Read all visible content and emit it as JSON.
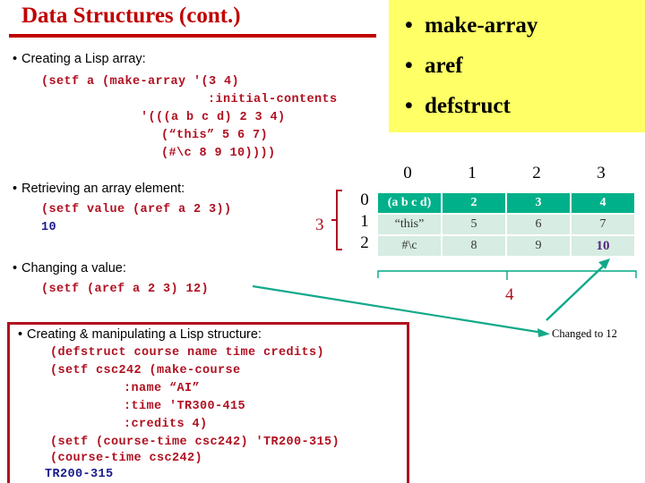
{
  "slide": {
    "title": "Data Structures (cont.)",
    "accent_red": "#c00000",
    "code_red": "#b01020",
    "output_blue": "#1a1a8c",
    "teal": "#00b08a",
    "teal_light": "#d7ece2",
    "yellow": "#ffff66",
    "highlight_purple": "#55257d"
  },
  "bullets": {
    "creating_array": "Creating a Lisp array:",
    "retrieving": "Retrieving an array element:",
    "changing": "Changing a value:",
    "structure": "Creating & manipulating a Lisp structure:"
  },
  "code": {
    "create_1": "(setf a (make-array '(3 4)",
    "create_2": ":initial-contents",
    "create_3": "'(((a b c d) 2 3 4)",
    "create_4": "(“this” 5 6 7)",
    "create_5": "(#\\c 8 9 10))))",
    "retrieve_1": "(setf value (aref a 2 3))",
    "retrieve_out": "10",
    "change_1": "(setf (aref a 2 3) 12)",
    "struct_1": "(defstruct course name time credits)",
    "struct_2": "(setf csc242 (make-course",
    "struct_3": ":name “AI”",
    "struct_4": ":time 'TR300-415",
    "struct_5": ":credits 4)",
    "struct_6": "(setf (course-time csc242) 'TR200-315)",
    "struct_7": "(course-time csc242)",
    "struct_out": "TR200-315"
  },
  "callout": {
    "items": [
      "make-array",
      "aref",
      "defstruct"
    ]
  },
  "matrix": {
    "col_headers": [
      "0",
      "1",
      "2",
      "3"
    ],
    "row_headers": [
      "0",
      "1",
      "2"
    ],
    "rows": [
      [
        "(a b c d)",
        "2",
        "3",
        "4"
      ],
      [
        "“this”",
        "5",
        "6",
        "7"
      ],
      [
        "#\\c",
        "8",
        "9",
        "10"
      ]
    ],
    "row_dim_label": "3",
    "col_dim_label": "4",
    "highlight_cell": "10"
  },
  "annotations": {
    "changed_note": "Changed to 12"
  }
}
